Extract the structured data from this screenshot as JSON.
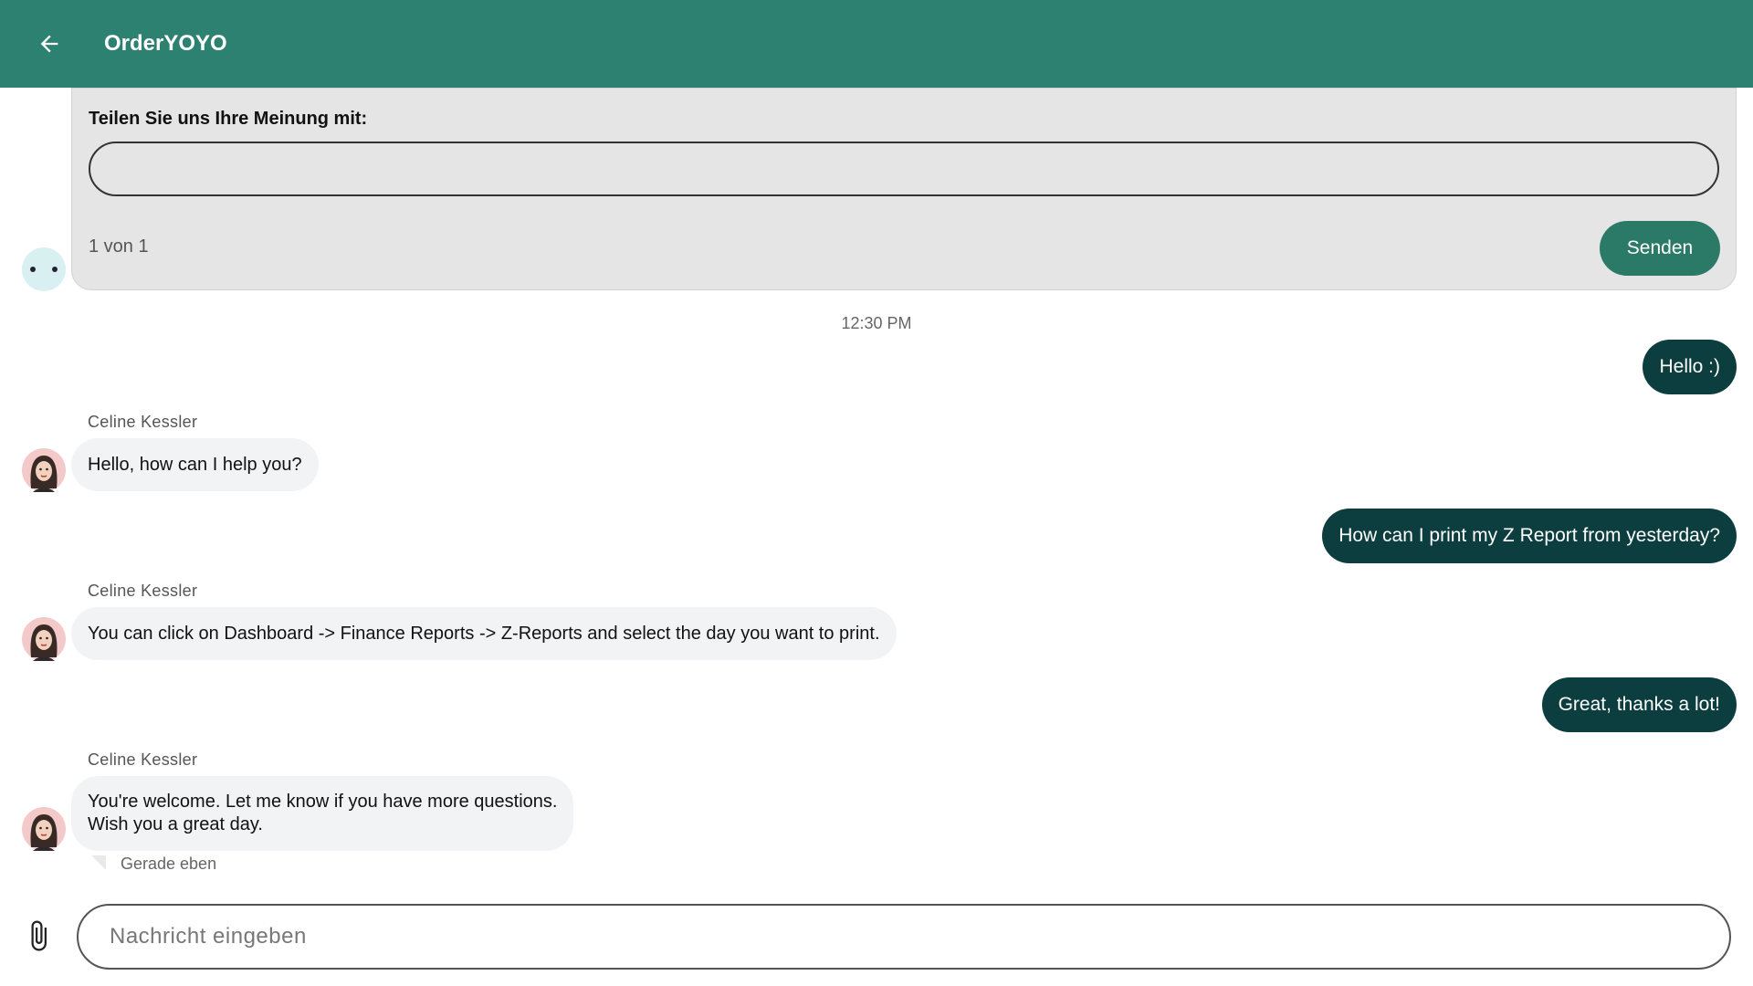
{
  "header": {
    "title": "OrderYOYO",
    "back_icon": "arrow-left-icon"
  },
  "survey": {
    "label": "Teilen Sie uns Ihre Meinung mit:",
    "input_value": "",
    "pager": "1 von 1",
    "send_label": "Senden"
  },
  "timestamp": "12:30 PM",
  "messages": [
    {
      "direction": "out",
      "text": "Hello :)"
    },
    {
      "direction": "in",
      "sender": "Celine Kessler",
      "text": "Hello, how can I help you?"
    },
    {
      "direction": "out",
      "text": "How can I print my Z Report from yesterday?"
    },
    {
      "direction": "in",
      "sender": "Celine Kessler",
      "text": "You can click on Dashboard -> Finance Reports -> Z-Reports and select the day you want to print."
    },
    {
      "direction": "out",
      "text": "Great, thanks a lot!"
    },
    {
      "direction": "in",
      "sender": "Celine Kessler",
      "text_line1": "You're welcome. Let me know if you have more questions.",
      "text_line2": "Wish you a great day."
    }
  ],
  "read_receipt": "Gerade eben",
  "composer": {
    "placeholder": "Nachricht eingeben",
    "value": "",
    "attach_icon": "paperclip-icon"
  },
  "colors": {
    "header": "#2d8171",
    "send_button": "#2b7a67",
    "outgoing_bubble": "#0d3e3f",
    "incoming_bubble": "#f2f3f5",
    "survey_card": "#e5e5e5"
  }
}
